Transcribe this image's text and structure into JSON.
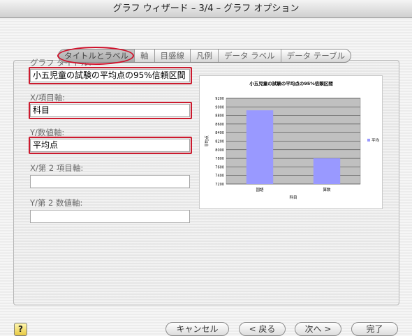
{
  "window": {
    "title": "グラフ ウィザード – 3/4 – グラフ オプション"
  },
  "tabs": [
    {
      "label": "タイトルとラベル"
    },
    {
      "label": "軸"
    },
    {
      "label": "目盛線"
    },
    {
      "label": "凡例"
    },
    {
      "label": "データ ラベル"
    },
    {
      "label": "データ テーブル"
    }
  ],
  "fields": {
    "chart_title": {
      "label": "グラフ タイトル:",
      "value": "小五児童の試験の平均点の95%信頼区間"
    },
    "x_axis": {
      "label": "X/項目軸:",
      "value": "科目"
    },
    "y_axis": {
      "label": "Y/数値軸:",
      "value": "平均点"
    },
    "x2_axis": {
      "label": "X/第 2 項目軸:",
      "value": ""
    },
    "y2_axis": {
      "label": "Y/第 2 数値軸:",
      "value": ""
    }
  },
  "chart_data": {
    "type": "bar",
    "title": "小五児童の試験の平均点の95%信頼区間",
    "xlabel": "科目",
    "ylabel": "平均点",
    "categories": [
      "国語",
      "算数"
    ],
    "series": [
      {
        "name": "平均",
        "values": [
          8920,
          7800
        ]
      }
    ],
    "ylim": [
      7200,
      9200
    ],
    "yticks": [
      "7200",
      "7400",
      "7600",
      "7800",
      "8000",
      "8200",
      "8400",
      "8600",
      "8800",
      "9000",
      "9200"
    ],
    "grid": true,
    "legend_position": "right",
    "bar_color": "#9999ff",
    "plot_background": "#c0c0c0"
  },
  "buttons": {
    "help": "?",
    "cancel": "キャンセル",
    "back": "< 戻る",
    "next": "次へ >",
    "finish": "完了"
  },
  "colors": {
    "annotation_red": "#cc1a2e",
    "bar": "#9999ff"
  }
}
